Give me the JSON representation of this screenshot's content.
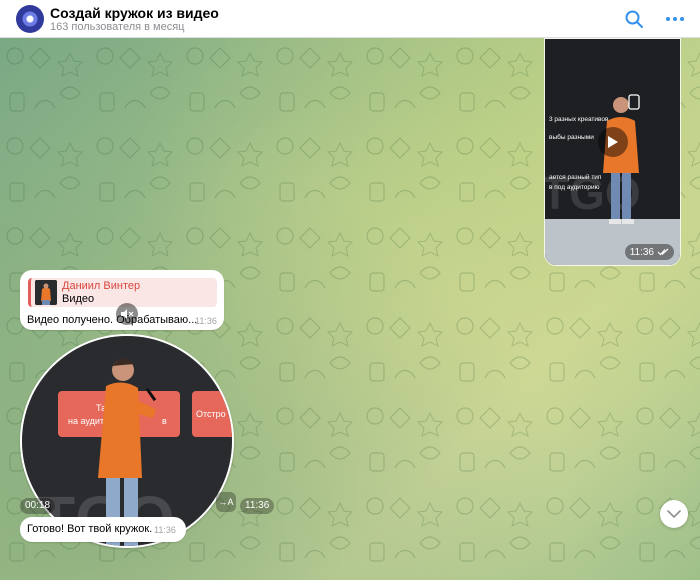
{
  "header": {
    "title": "Создай кружок из видео",
    "subtitle": "163 пользователя в месяц"
  },
  "video_message": {
    "time": "11:36",
    "status_icon": "double-check-icon",
    "slide_lines": [
      "3 разных креативов",
      "выбы разными",
      "ается разный тип",
      "в под аудиторию",
      "TGO"
    ]
  },
  "reply_message": {
    "quote_author": "Даниил Винтер",
    "quote_text": "Видео",
    "text": "Видео получено. Обрабатываю...",
    "time": "11:36"
  },
  "round_video": {
    "duration": "00:18",
    "translate_label": "→A",
    "time": "11:36",
    "mute_icon": "speaker-muted-icon",
    "slide_text_1": "Тар",
    "slide_text_2": "на аудит",
    "slide_text_3": "Отстро",
    "slide_text_4": "в",
    "big_text": "TGO"
  },
  "done_message": {
    "text": "Готово! Вот твой кружок.",
    "time": "11:36"
  },
  "colors": {
    "accent": "#3390ec",
    "quote_bar": "#e25c5c",
    "quote_name": "#d8473e",
    "hoodie": "#e8772a",
    "slide_red": "#e5685a"
  }
}
